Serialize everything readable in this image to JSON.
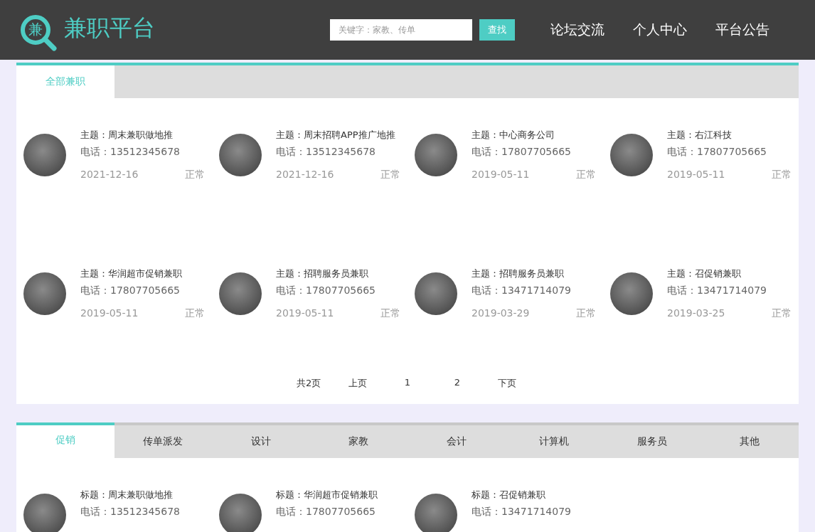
{
  "header": {
    "logo_text": "兼职平台",
    "logo_icon_char": "兼",
    "search": {
      "placeholder": "关键字：家教、传单",
      "button": "查找"
    },
    "nav": [
      "论坛交流",
      "个人中心",
      "平台公告"
    ]
  },
  "all_jobs": {
    "tabs": [
      {
        "label": "全部兼职",
        "selected": true
      }
    ],
    "cards": [
      {
        "title": "主题：周末兼职做地推",
        "phone": "电话：13512345678",
        "date": "2021-12-16",
        "status": "正常"
      },
      {
        "title": "主题：周末招聘APP推广地推",
        "phone": "电话：13512345678",
        "date": "2021-12-16",
        "status": "正常"
      },
      {
        "title": "主题：中心商务公司",
        "phone": "电话：17807705665",
        "date": "2019-05-11",
        "status": "正常"
      },
      {
        "title": "主题：右江科技",
        "phone": "电话：17807705665",
        "date": "2019-05-11",
        "status": "正常"
      },
      {
        "title": "主题：华润超市促销兼职",
        "phone": "电话：17807705665",
        "date": "2019-05-11",
        "status": "正常"
      },
      {
        "title": "主题：招聘服务员兼职",
        "phone": "电话：17807705665",
        "date": "2019-05-11",
        "status": "正常"
      },
      {
        "title": "主题：招聘服务员兼职",
        "phone": "电话：13471714079",
        "date": "2019-03-29",
        "status": "正常"
      },
      {
        "title": "主题：召促销兼职",
        "phone": "电话：13471714079",
        "date": "2019-03-25",
        "status": "正常"
      }
    ],
    "pagination": {
      "total": "共2页",
      "prev": "上页",
      "pages": [
        "1",
        "2"
      ],
      "next": "下页"
    }
  },
  "categories": {
    "tabs": [
      {
        "label": "促销",
        "selected": true
      },
      {
        "label": "传单派发",
        "selected": false
      },
      {
        "label": "设计",
        "selected": false
      },
      {
        "label": "家教",
        "selected": false
      },
      {
        "label": "会计",
        "selected": false
      },
      {
        "label": "计算机",
        "selected": false
      },
      {
        "label": "服务员",
        "selected": false
      },
      {
        "label": "其他",
        "selected": false
      }
    ],
    "cards": [
      {
        "title": "标题：周末兼职做地推",
        "phone": "电话：13512345678"
      },
      {
        "title": "标题：华润超市促销兼职",
        "phone": "电话：17807705665"
      },
      {
        "title": "标题：召促销兼职",
        "phone": "电话：13471714079"
      }
    ]
  }
}
